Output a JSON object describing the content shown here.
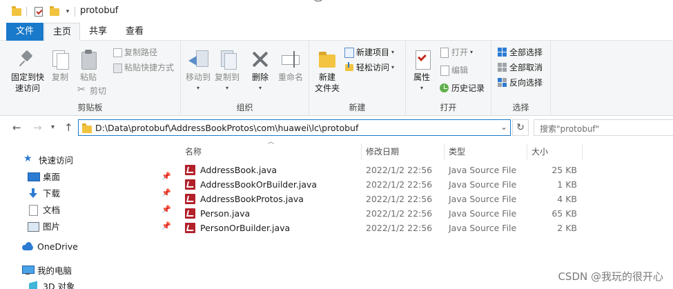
{
  "window": {
    "title": "protobuf"
  },
  "tabs": {
    "file": "文件",
    "home": "主页",
    "share": "共享",
    "view": "查看"
  },
  "ribbon": {
    "clipboard": {
      "label": "剪贴板",
      "pin_quick_access": "固定到快\n速访问",
      "copy": "复制",
      "paste": "粘贴",
      "copy_path": "复制路径",
      "paste_shortcut": "粘贴快捷方式",
      "cut": "剪切"
    },
    "organize": {
      "label": "组织",
      "move_to": "移动到",
      "copy_to": "复制到",
      "delete": "删除",
      "rename": "重命名"
    },
    "new": {
      "label": "新建",
      "new_folder": "新建\n文件夹",
      "new_item": "新建项目",
      "easy_access": "轻松访问"
    },
    "open": {
      "label": "打开",
      "properties": "属性",
      "open": "打开",
      "edit": "编辑",
      "history": "历史记录"
    },
    "select": {
      "label": "选择",
      "select_all": "全部选择",
      "select_none": "全部取消",
      "invert": "反向选择"
    }
  },
  "address": {
    "path": "D:\\Data\\protobuf\\AddressBookProtos\\com\\huawei\\lc\\protobuf",
    "search_placeholder": "搜索\"protobuf\""
  },
  "navpane": {
    "items": [
      {
        "label": "快速访问",
        "icon": "star-icon"
      },
      {
        "label": "桌面",
        "icon": "desktop-icon"
      },
      {
        "label": "下载",
        "icon": "download-icon"
      },
      {
        "label": "文档",
        "icon": "document-icon"
      },
      {
        "label": "图片",
        "icon": "picture-icon"
      },
      {
        "label": "OneDrive",
        "icon": "cloud-icon"
      },
      {
        "label": "我的电脑",
        "icon": "computer-icon"
      },
      {
        "label": "3D 对象",
        "icon": "3d-objects-icon"
      }
    ]
  },
  "filelist": {
    "columns": {
      "name": "名称",
      "date": "修改日期",
      "type": "类型",
      "size": "大小"
    },
    "rows": [
      {
        "name": "AddressBook.java",
        "date": "2022/1/2 22:56",
        "type": "Java Source File",
        "size": "25 KB"
      },
      {
        "name": "AddressBookOrBuilder.java",
        "date": "2022/1/2 22:56",
        "type": "Java Source File",
        "size": "1 KB"
      },
      {
        "name": "AddressBookProtos.java",
        "date": "2022/1/2 22:56",
        "type": "Java Source File",
        "size": "4 KB"
      },
      {
        "name": "Person.java",
        "date": "2022/1/2 22:56",
        "type": "Java Source File",
        "size": "65 KB"
      },
      {
        "name": "PersonOrBuilder.java",
        "date": "2022/1/2 22:56",
        "type": "Java Source File",
        "size": "2 KB"
      }
    ]
  },
  "watermark": "CSDN @我玩的很开心"
}
